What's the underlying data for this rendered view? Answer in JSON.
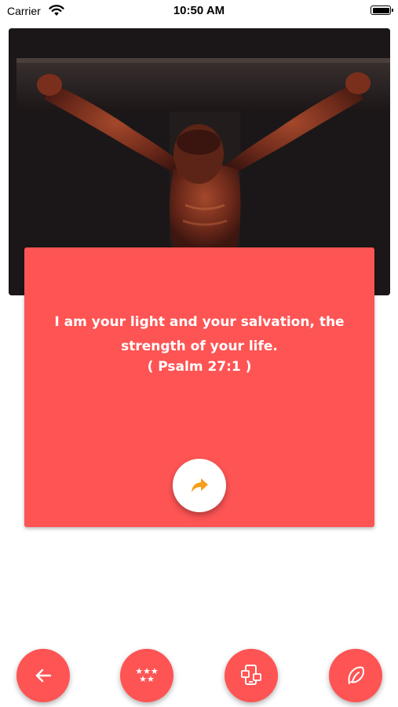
{
  "status_bar": {
    "carrier": "Carrier",
    "time": "10:50 AM"
  },
  "verse_card": {
    "verse_text": "I am your light and your salvation, the strength of your life.",
    "reference": "( Psalm 27:1 )",
    "share_icon": "share-arrow-icon",
    "background_color": "#fe5454",
    "icon_color": "#f59e1b"
  },
  "hero_image": {
    "subject": "crucifix"
  },
  "bottom_bar": {
    "buttons": [
      {
        "icon": "back-arrow-icon"
      },
      {
        "icon": "stars-rate-icon"
      },
      {
        "icon": "more-apps-icon"
      },
      {
        "icon": "about-icon"
      }
    ]
  }
}
